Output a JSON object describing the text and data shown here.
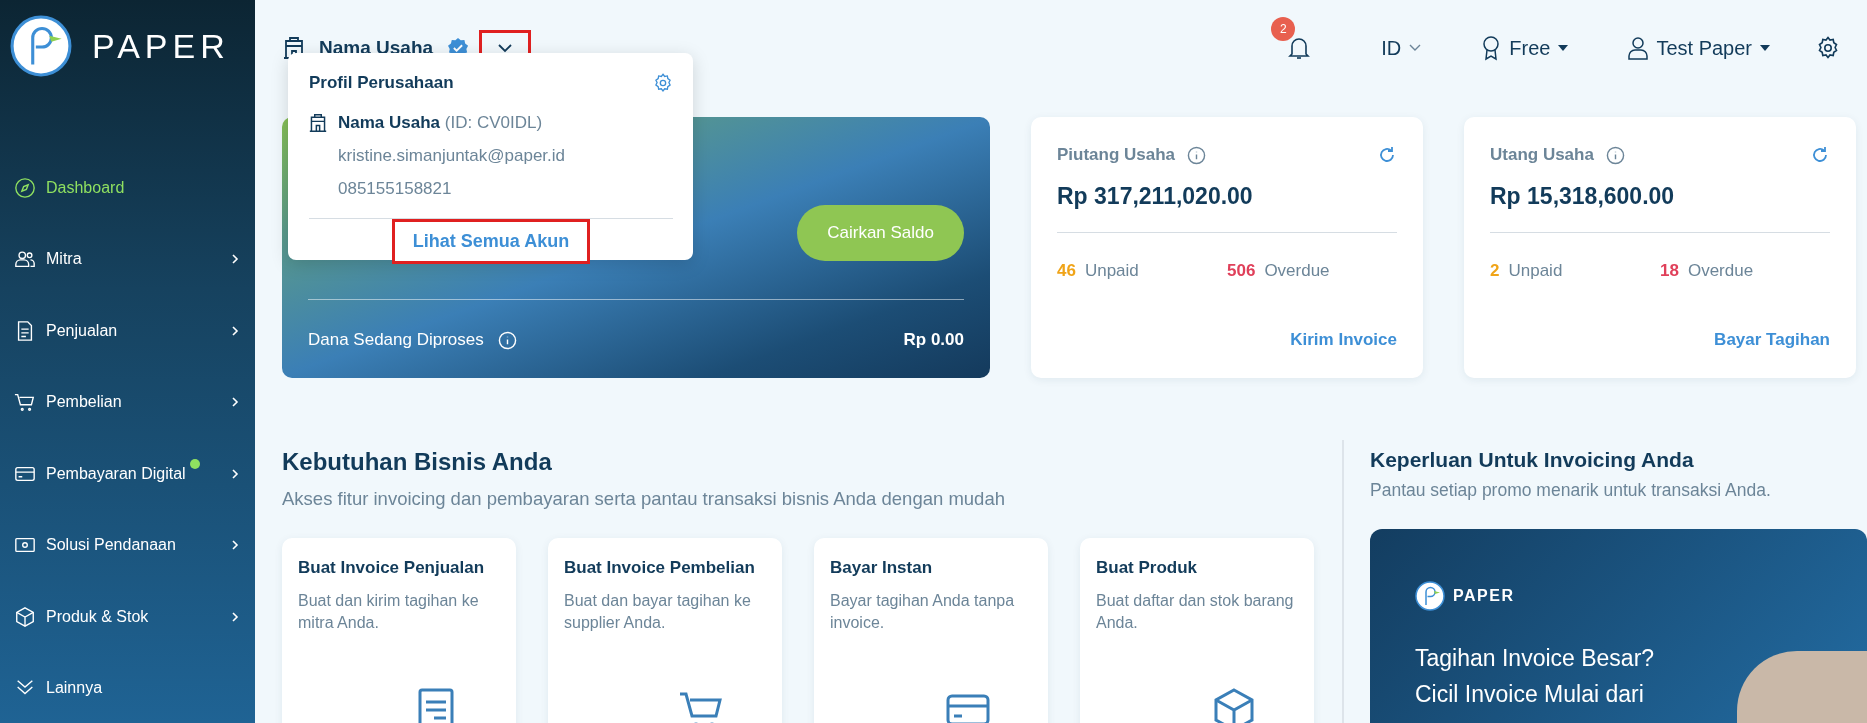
{
  "sidebar": {
    "logo_text": "PAPER",
    "items": [
      {
        "label": "Dashboard",
        "selected": true,
        "expandable": false,
        "new_dot": false
      },
      {
        "label": "Mitra",
        "selected": false,
        "expandable": true,
        "new_dot": false
      },
      {
        "label": "Penjualan",
        "selected": false,
        "expandable": true,
        "new_dot": false
      },
      {
        "label": "Pembelian",
        "selected": false,
        "expandable": true,
        "new_dot": false
      },
      {
        "label": "Pembayaran Digital",
        "selected": false,
        "expandable": true,
        "new_dot": true
      },
      {
        "label": "Solusi Pendanaan",
        "selected": false,
        "expandable": true,
        "new_dot": false
      },
      {
        "label": "Produk & Stok",
        "selected": false,
        "expandable": true,
        "new_dot": false
      },
      {
        "label": "Lainnya",
        "selected": false,
        "expandable": false,
        "new_dot": false
      }
    ]
  },
  "topbar": {
    "company_name": "Nama Usaha",
    "verified": true,
    "dropdown_expanded": true,
    "dropdown_highlighted": true,
    "notification_count": "2",
    "language": "ID",
    "plan": "Free",
    "user": "Test Paper"
  },
  "profile_popup": {
    "title": "Profil Perusahaan",
    "company_name": "Nama Usaha",
    "company_id": "(ID: CV0IDL)",
    "email": "kristine.simanjuntak@paper.id",
    "phone": "085155158821",
    "link": {
      "label": "Lihat Semua Akun",
      "highlighted": true
    }
  },
  "balance_card": {
    "button": "Cairkan Saldo",
    "processing_label": "Dana Sedang Diproses",
    "processing_amount": "Rp 0.00"
  },
  "summary_cards": [
    {
      "title": "Piutang Usaha",
      "amount": "Rp 317,211,020.00",
      "unpaid_count": "46",
      "unpaid_label": "Unpaid",
      "overdue_count": "506",
      "overdue_label": "Overdue",
      "action": "Kirim Invoice"
    },
    {
      "title": "Utang Usaha",
      "amount": "Rp 15,318,600.00",
      "unpaid_count": "2",
      "unpaid_label": "Unpaid",
      "overdue_count": "18",
      "overdue_label": "Overdue",
      "action": "Bayar Tagihan"
    }
  ],
  "business_needs": {
    "title": "Kebutuhan Bisnis Anda",
    "subtitle": "Akses fitur invoicing dan pembayaran serta pantau transaksi bisnis Anda dengan mudah",
    "cards": [
      {
        "title": "Buat Invoice Penjualan",
        "description": "Buat dan kirim tagihan ke mitra Anda."
      },
      {
        "title": "Buat Invoice Pembelian",
        "description": "Buat dan bayar tagihan ke supplier Anda."
      },
      {
        "title": "Bayar Instan",
        "description": "Bayar tagihan Anda tanpa invoice."
      },
      {
        "title": "Buat Produk",
        "description": "Buat daftar dan stok barang Anda."
      }
    ]
  },
  "promo_section": {
    "title": "Keperluan Untuk Invoicing Anda",
    "subtitle": "Pantau setiap promo menarik untuk transaksi Anda.",
    "banner": {
      "logo_text": "PAPER",
      "headline_lines": [
        "Tagihan Invoice Besar?",
        "Cicil Invoice Mulai dari"
      ]
    }
  }
}
